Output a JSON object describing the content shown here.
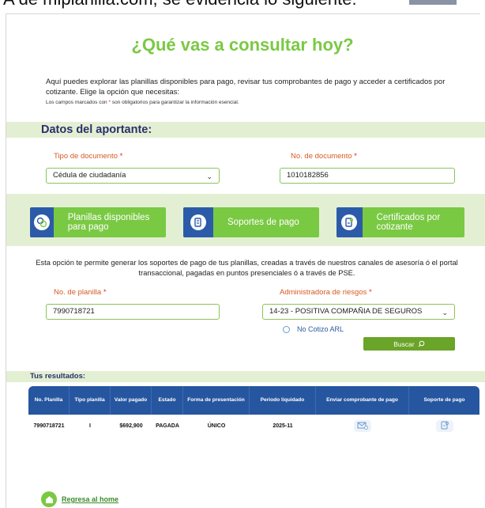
{
  "cutoff_text": "A de miplanilla.com, se evidencia lo siguiente:",
  "title": "¿Qué vas a consultar hoy?",
  "intro": "Aquí puedes explorar las planillas disponibles para pago, revisar tus comprobantes de pago y acceder a certificados por cotizante. Elige la opción que necesitas:",
  "note_prefix": "Los campos marcados con ",
  "note_star": "*",
  "note_suffix": " son obligatorios para garantizar la información esencial.",
  "section_title": "Datos del aportante:",
  "required_mark": "*",
  "doc_type": {
    "label": "Tipo de documento",
    "value": "Cédula de ciudadanía"
  },
  "doc_number": {
    "label": "No. de documento",
    "value": "1010182856"
  },
  "options": [
    {
      "label": "Planillas disponibles para pago",
      "icon": "coins-icon"
    },
    {
      "label": "Soportes de pago",
      "icon": "document-icon"
    },
    {
      "label": "Certificados por cotizante",
      "icon": "certificate-icon"
    }
  ],
  "description": "Esta opción te permite generar los soportes de pago de tus planillas, creadas a través de nuestros canales de asesoría ó el portal transaccional, pagadas en puntos presenciales ó a través de PSE.",
  "planilla": {
    "label": "No. de planilla",
    "value": "7990718721"
  },
  "arl": {
    "label": "Administradora de riesgos",
    "value": "14-23 - POSITIVA COMPAÑIA DE SEGUROS"
  },
  "no_cotizo": "No Cotizo ARL",
  "search_label": "Buscar",
  "results_title": "Tus resultados:",
  "table": {
    "headers": [
      "No. Planilla",
      "Tipo planilla",
      "Valor pagado",
      "Estado",
      "Forma de presentación",
      "Periodo liquidado",
      "Enviar comprobante de pago",
      "Soporte de pago"
    ],
    "row": {
      "planilla": "7990718721",
      "tipo": "I",
      "valor": "$692,900",
      "estado": "PAGADA",
      "forma": "ÚNICO",
      "periodo": "2025-11"
    }
  },
  "home_link": "Regresa al home",
  "colors": {
    "green": "#7ac943",
    "blue": "#26569f",
    "navy": "#2c2f6b",
    "orange": "#d75a23",
    "band": "#e3efd3"
  }
}
